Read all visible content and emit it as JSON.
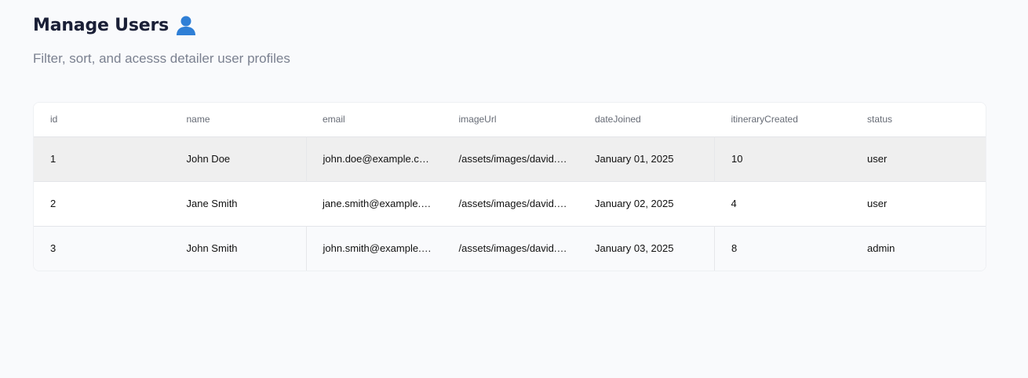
{
  "page": {
    "title": "Manage Users",
    "title_icon": "bust-in-silhouette-icon",
    "subtitle": "Filter, sort, and acesss detailer user profiles"
  },
  "table": {
    "columns": [
      "id",
      "name",
      "email",
      "imageUrl",
      "dateJoined",
      "itineraryCreated",
      "status"
    ],
    "rows": [
      [
        "1",
        "John Doe",
        "john.doe@example.com",
        "/assets/images/david.webp",
        "January 01, 2025",
        "10",
        "user"
      ],
      [
        "2",
        "Jane Smith",
        "jane.smith@example.com",
        "/assets/images/david.webp",
        "January 02, 2025",
        "4",
        "user"
      ],
      [
        "3",
        "John Smith",
        "john.smith@example.com",
        "/assets/images/david.webp",
        "January 03, 2025",
        "8",
        "admin"
      ]
    ]
  },
  "colors": {
    "background": "#f9fafc",
    "title": "#1a1f36",
    "subtitle": "#7b8190",
    "header_text": "#666b75",
    "highlight_row": "#efefef",
    "icon_blue": "#2f7fd6"
  }
}
